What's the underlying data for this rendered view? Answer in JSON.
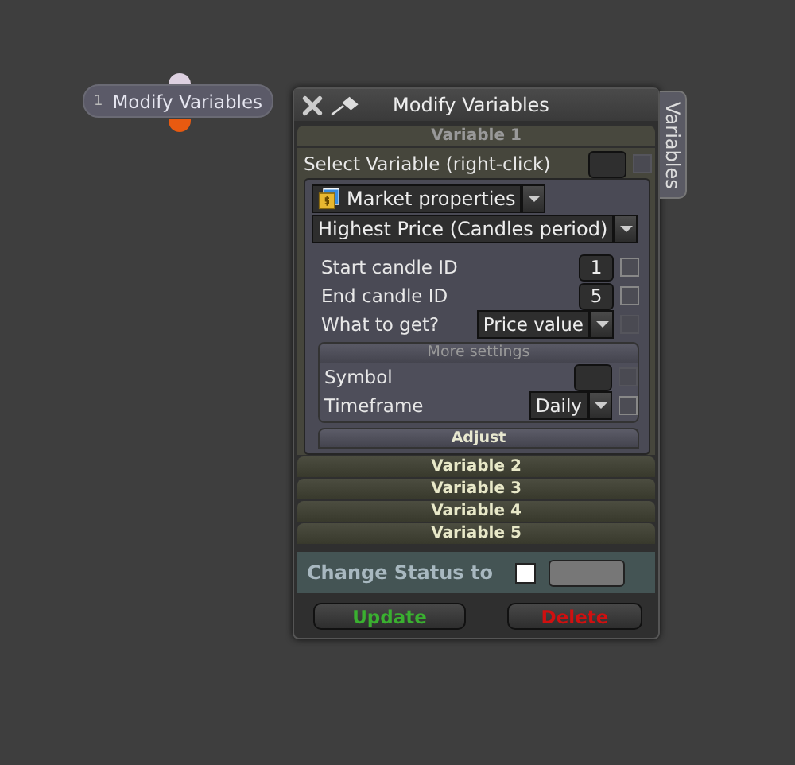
{
  "node": {
    "index": "1",
    "title": "Modify Variables"
  },
  "window": {
    "title": "Modify Variables"
  },
  "side_tab": {
    "label": "Variables"
  },
  "variables": [
    {
      "title": "Variable 1",
      "expanded": true,
      "select": {
        "label": "Select Variable (right-click)",
        "checkbox_disabled": true
      },
      "category": "Market properties",
      "property": "Highest Price (Candles period)",
      "fields": [
        {
          "kind": "input",
          "label": "Start candle ID",
          "value": "1",
          "checkbox_disabled": false
        },
        {
          "kind": "input",
          "label": "End candle ID",
          "value": "5",
          "checkbox_disabled": false
        },
        {
          "kind": "dropdown",
          "label": "What to get?",
          "value": "Price value",
          "checkbox_disabled": true
        }
      ],
      "more": {
        "title": "More settings",
        "fields": [
          {
            "kind": "input",
            "label": "Symbol",
            "checkbox_disabled": true
          },
          {
            "kind": "dropdown",
            "label": "Timeframe",
            "value": "Daily",
            "checkbox_disabled": false
          }
        ]
      },
      "adjust": "Adjust"
    },
    {
      "title": "Variable 2",
      "expanded": false
    },
    {
      "title": "Variable 3",
      "expanded": false
    },
    {
      "title": "Variable 4",
      "expanded": false
    },
    {
      "title": "Variable 5",
      "expanded": false
    }
  ],
  "status": {
    "label": "Change Status to",
    "checked": false
  },
  "buttons": [
    {
      "label": "Update",
      "kind": "update"
    },
    {
      "label": "Delete",
      "kind": "delete"
    }
  ]
}
